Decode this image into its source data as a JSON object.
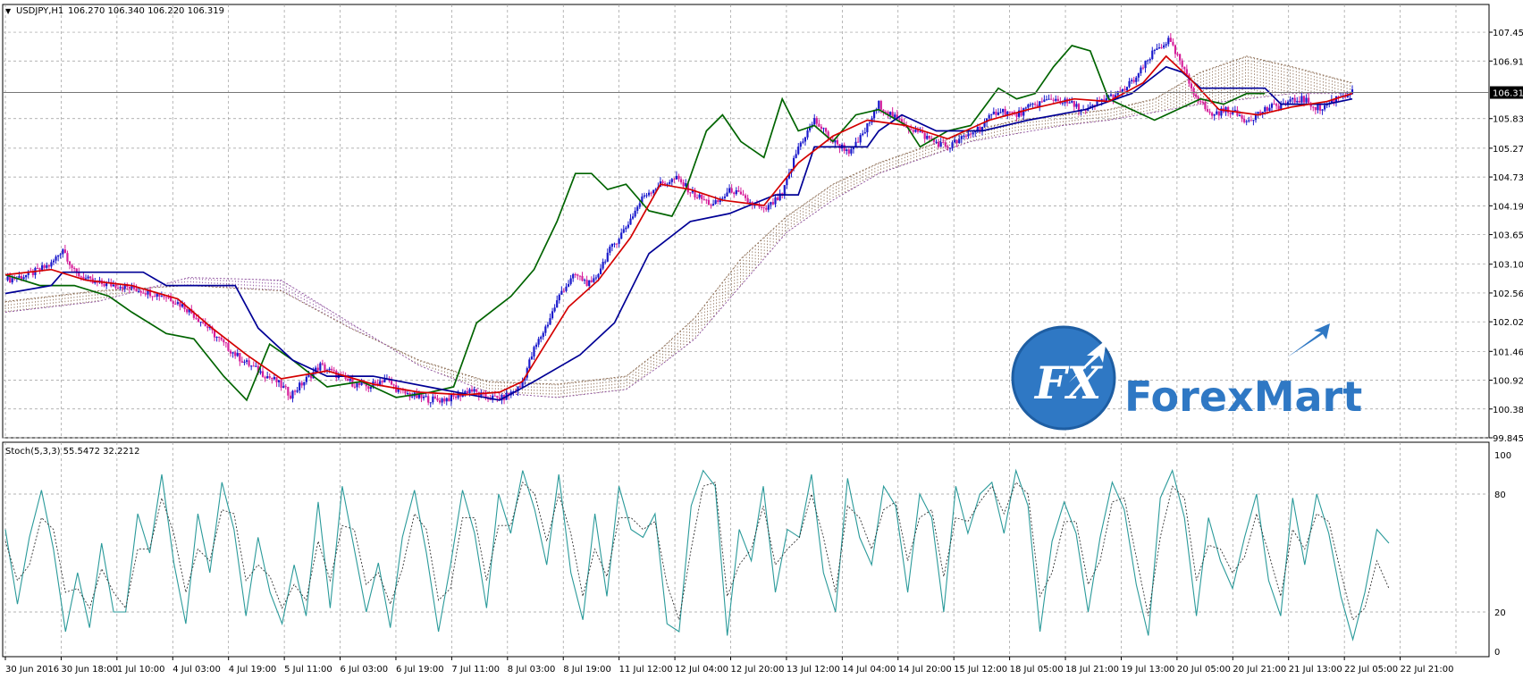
{
  "window": {
    "symbol_label": "USDJPY,H1",
    "ohlc_label": "106.270 106.340 106.220 106.319",
    "current_price_label": "106.319"
  },
  "logo": {
    "text": "ForexMart",
    "mark": "FX"
  },
  "colors": {
    "candle_bull": "#1a1acc",
    "candle_bear": "#d61f9a",
    "tenkan": "#d40000",
    "kijun": "#000096",
    "chikou": "#006400",
    "kumo_a": "#8a6a50",
    "kumo_b": "#8a4a9a",
    "stoch_main": "#2a9a9a",
    "stoch_signal": "#333333",
    "grid": "#9a9a9a",
    "logo_blue": "#2f78c4"
  },
  "chart_data": [
    {
      "type": "candlestick",
      "symbol": "USDJPY",
      "timeframe": "H1",
      "indicators": [
        "Ichimoku",
        "Kumo"
      ],
      "ylim": [
        99.845,
        107.97
      ],
      "y_ticks": [
        "107.450",
        "106.910",
        "105.830",
        "105.275",
        "104.735",
        "104.195",
        "103.655",
        "103.100",
        "102.560",
        "102.020",
        "101.465",
        "100.925",
        "100.385",
        "99.845"
      ],
      "x_ticks": [
        "30 Jun 2016",
        "30 Jun 18:00",
        "1 Jul 10:00",
        "4 Jul 03:00",
        "4 Jul 19:00",
        "5 Jul 11:00",
        "6 Jul 03:00",
        "6 Jul 19:00",
        "7 Jul 11:00",
        "8 Jul 03:00",
        "8 Jul 19:00",
        "11 Jul 12:00",
        "12 Jul 04:00",
        "12 Jul 20:00",
        "13 Jul 12:00",
        "14 Jul 04:00",
        "14 Jul 20:00",
        "15 Jul 12:00",
        "18 Jul 05:00",
        "18 Jul 21:00",
        "19 Jul 13:00",
        "20 Jul 05:00",
        "20 Jul 21:00",
        "21 Jul 13:00",
        "22 Jul 05:00",
        "22 Jul 21:00"
      ],
      "close_path": [
        [
          0,
          102.8
        ],
        [
          10,
          102.9
        ],
        [
          20,
          103.1
        ],
        [
          25,
          103.4
        ],
        [
          30,
          102.95
        ],
        [
          38,
          102.75
        ],
        [
          50,
          102.7
        ],
        [
          60,
          102.6
        ],
        [
          70,
          102.5
        ],
        [
          78,
          102.3
        ],
        [
          86,
          102.0
        ],
        [
          95,
          101.6
        ],
        [
          103,
          101.3
        ],
        [
          110,
          101.1
        ],
        [
          118,
          100.9
        ],
        [
          124,
          100.65
        ],
        [
          130,
          100.9
        ],
        [
          137,
          101.2
        ],
        [
          145,
          101.0
        ],
        [
          152,
          100.85
        ],
        [
          158,
          100.8
        ],
        [
          165,
          100.95
        ],
        [
          172,
          100.7
        ],
        [
          180,
          100.6
        ],
        [
          188,
          100.55
        ],
        [
          195,
          100.6
        ],
        [
          202,
          100.75
        ],
        [
          209,
          100.6
        ],
        [
          216,
          100.58
        ],
        [
          224,
          100.8
        ],
        [
          230,
          101.5
        ],
        [
          236,
          102.0
        ],
        [
          242,
          102.6
        ],
        [
          248,
          102.9
        ],
        [
          255,
          102.7
        ],
        [
          262,
          103.3
        ],
        [
          270,
          103.8
        ],
        [
          278,
          104.4
        ],
        [
          285,
          104.6
        ],
        [
          292,
          104.7
        ],
        [
          300,
          104.4
        ],
        [
          308,
          104.2
        ],
        [
          316,
          104.5
        ],
        [
          322,
          104.3
        ],
        [
          330,
          104.1
        ],
        [
          338,
          104.4
        ],
        [
          345,
          105.3
        ],
        [
          352,
          105.8
        ],
        [
          360,
          105.4
        ],
        [
          368,
          105.2
        ],
        [
          374,
          105.6
        ],
        [
          380,
          106.1
        ],
        [
          388,
          105.8
        ],
        [
          396,
          105.6
        ],
        [
          404,
          105.4
        ],
        [
          410,
          105.3
        ],
        [
          418,
          105.5
        ],
        [
          425,
          105.7
        ],
        [
          432,
          106.0
        ],
        [
          440,
          105.9
        ],
        [
          448,
          106.1
        ],
        [
          456,
          106.2
        ],
        [
          464,
          106.1
        ],
        [
          470,
          105.95
        ],
        [
          478,
          106.2
        ],
        [
          485,
          106.3
        ],
        [
          492,
          106.6
        ],
        [
          500,
          107.1
        ],
        [
          506,
          107.3
        ],
        [
          511,
          106.9
        ],
        [
          516,
          106.4
        ],
        [
          524,
          105.9
        ],
        [
          532,
          106.0
        ],
        [
          540,
          105.8
        ],
        [
          548,
          106.0
        ],
        [
          556,
          106.1
        ],
        [
          564,
          106.2
        ],
        [
          572,
          106.0
        ],
        [
          580,
          106.25
        ],
        [
          586,
          106.319
        ]
      ],
      "tenkan_path": [
        [
          0,
          102.9
        ],
        [
          20,
          103.0
        ],
        [
          35,
          102.8
        ],
        [
          55,
          102.7
        ],
        [
          75,
          102.45
        ],
        [
          90,
          101.9
        ],
        [
          105,
          101.4
        ],
        [
          120,
          100.95
        ],
        [
          140,
          101.1
        ],
        [
          160,
          100.85
        ],
        [
          180,
          100.7
        ],
        [
          200,
          100.65
        ],
        [
          215,
          100.7
        ],
        [
          225,
          100.9
        ],
        [
          235,
          101.6
        ],
        [
          245,
          102.3
        ],
        [
          258,
          102.8
        ],
        [
          272,
          103.6
        ],
        [
          285,
          104.6
        ],
        [
          298,
          104.5
        ],
        [
          312,
          104.3
        ],
        [
          330,
          104.2
        ],
        [
          345,
          105.0
        ],
        [
          360,
          105.5
        ],
        [
          375,
          105.8
        ],
        [
          392,
          105.7
        ],
        [
          410,
          105.45
        ],
        [
          428,
          105.8
        ],
        [
          445,
          106.0
        ],
        [
          465,
          106.2
        ],
        [
          480,
          106.15
        ],
        [
          495,
          106.5
        ],
        [
          505,
          107.0
        ],
        [
          515,
          106.6
        ],
        [
          528,
          106.0
        ],
        [
          545,
          105.9
        ],
        [
          560,
          106.05
        ],
        [
          575,
          106.15
        ],
        [
          586,
          106.3
        ]
      ],
      "kijun_path": [
        [
          0,
          102.55
        ],
        [
          20,
          102.7
        ],
        [
          25,
          102.95
        ],
        [
          60,
          102.95
        ],
        [
          70,
          102.7
        ],
        [
          100,
          102.7
        ],
        [
          110,
          101.9
        ],
        [
          125,
          101.3
        ],
        [
          140,
          101.0
        ],
        [
          160,
          101.0
        ],
        [
          190,
          100.75
        ],
        [
          215,
          100.55
        ],
        [
          230,
          100.9
        ],
        [
          250,
          101.4
        ],
        [
          265,
          102.0
        ],
        [
          280,
          103.3
        ],
        [
          298,
          103.9
        ],
        [
          315,
          104.05
        ],
        [
          335,
          104.4
        ],
        [
          345,
          104.4
        ],
        [
          352,
          105.3
        ],
        [
          375,
          105.3
        ],
        [
          380,
          105.6
        ],
        [
          390,
          105.9
        ],
        [
          405,
          105.6
        ],
        [
          425,
          105.6
        ],
        [
          445,
          105.8
        ],
        [
          470,
          106.0
        ],
        [
          490,
          106.3
        ],
        [
          505,
          106.8
        ],
        [
          512,
          106.7
        ],
        [
          520,
          106.4
        ],
        [
          548,
          106.4
        ],
        [
          555,
          106.1
        ],
        [
          575,
          106.1
        ],
        [
          586,
          106.2
        ]
      ],
      "chikou_path": [
        [
          0,
          102.9
        ],
        [
          15,
          102.7
        ],
        [
          30,
          102.7
        ],
        [
          45,
          102.5
        ],
        [
          55,
          102.2
        ],
        [
          70,
          101.8
        ],
        [
          82,
          101.7
        ],
        [
          95,
          101.0
        ],
        [
          105,
          100.55
        ],
        [
          115,
          101.6
        ],
        [
          125,
          101.3
        ],
        [
          140,
          100.8
        ],
        [
          155,
          100.9
        ],
        [
          170,
          100.6
        ],
        [
          185,
          100.7
        ],
        [
          195,
          100.8
        ],
        [
          205,
          102.0
        ],
        [
          220,
          102.5
        ],
        [
          230,
          103.0
        ],
        [
          240,
          103.9
        ],
        [
          248,
          104.8
        ],
        [
          255,
          104.8
        ],
        [
          262,
          104.5
        ],
        [
          270,
          104.6
        ],
        [
          280,
          104.1
        ],
        [
          290,
          104.0
        ],
        [
          296,
          104.5
        ],
        [
          305,
          105.6
        ],
        [
          312,
          105.9
        ],
        [
          320,
          105.4
        ],
        [
          330,
          105.1
        ],
        [
          338,
          106.2
        ],
        [
          345,
          105.6
        ],
        [
          352,
          105.7
        ],
        [
          360,
          105.4
        ],
        [
          370,
          105.9
        ],
        [
          380,
          106.0
        ],
        [
          392,
          105.7
        ],
        [
          398,
          105.3
        ],
        [
          410,
          105.6
        ],
        [
          420,
          105.7
        ],
        [
          432,
          106.4
        ],
        [
          440,
          106.2
        ],
        [
          448,
          106.3
        ],
        [
          456,
          106.8
        ],
        [
          464,
          107.2
        ],
        [
          472,
          107.1
        ],
        [
          480,
          106.2
        ],
        [
          490,
          106.0
        ],
        [
          500,
          105.8
        ],
        [
          510,
          106.0
        ],
        [
          520,
          106.2
        ],
        [
          530,
          106.1
        ],
        [
          540,
          106.3
        ],
        [
          548,
          106.3
        ]
      ],
      "kumo": {
        "span_a": [
          [
            0,
            102.4
          ],
          [
            40,
            102.6
          ],
          [
            80,
            102.7
          ],
          [
            120,
            102.6
          ],
          [
            150,
            101.9
          ],
          [
            180,
            101.3
          ],
          [
            210,
            100.9
          ],
          [
            240,
            100.85
          ],
          [
            270,
            101.0
          ],
          [
            285,
            101.5
          ],
          [
            300,
            102.1
          ],
          [
            320,
            103.2
          ],
          [
            340,
            104.0
          ],
          [
            360,
            104.6
          ],
          [
            380,
            105.0
          ],
          [
            400,
            105.3
          ],
          [
            420,
            105.6
          ],
          [
            440,
            105.8
          ],
          [
            460,
            105.9
          ],
          [
            480,
            106.0
          ],
          [
            500,
            106.2
          ],
          [
            520,
            106.7
          ],
          [
            540,
            107.0
          ],
          [
            560,
            106.8
          ],
          [
            586,
            106.5
          ]
        ],
        "span_b": [
          [
            0,
            102.2
          ],
          [
            40,
            102.4
          ],
          [
            80,
            102.85
          ],
          [
            120,
            102.8
          ],
          [
            150,
            102.0
          ],
          [
            180,
            101.2
          ],
          [
            210,
            100.7
          ],
          [
            240,
            100.6
          ],
          [
            270,
            100.75
          ],
          [
            285,
            101.2
          ],
          [
            300,
            101.7
          ],
          [
            320,
            102.7
          ],
          [
            340,
            103.7
          ],
          [
            360,
            104.3
          ],
          [
            380,
            104.8
          ],
          [
            400,
            105.1
          ],
          [
            420,
            105.4
          ],
          [
            440,
            105.55
          ],
          [
            460,
            105.7
          ],
          [
            480,
            105.8
          ],
          [
            500,
            105.95
          ],
          [
            520,
            106.1
          ],
          [
            540,
            106.2
          ],
          [
            560,
            106.3
          ],
          [
            586,
            106.3
          ]
        ]
      }
    },
    {
      "type": "line",
      "indicator": "Stochastic",
      "label": "Stoch(5,3,3) 55.5472 32.2212",
      "ylim": [
        0,
        100
      ],
      "y_ticks": [
        "100",
        "80",
        "20",
        "0"
      ],
      "series": [
        {
          "role": "main",
          "values": [
            62,
            24,
            58,
            82,
            52,
            10,
            40,
            12,
            55,
            20,
            20,
            70,
            50,
            90,
            45,
            14,
            70,
            40,
            86,
            62,
            18,
            58,
            30,
            14,
            44,
            18,
            76,
            22,
            84,
            52,
            20,
            45,
            12,
            58,
            82,
            50,
            10,
            44,
            82,
            60,
            22,
            80,
            60,
            92,
            72,
            44,
            90,
            40,
            16,
            70,
            28,
            84,
            62,
            58,
            70,
            14,
            10,
            74,
            92,
            84,
            8,
            62,
            46,
            84,
            30,
            62,
            58,
            90,
            40,
            20,
            88,
            58,
            44,
            84,
            74,
            30,
            80,
            68,
            20,
            84,
            60,
            80,
            86,
            60,
            92,
            74,
            10,
            56,
            76,
            60,
            20,
            58,
            86,
            72,
            34,
            8,
            78,
            92,
            68,
            18,
            68,
            46,
            32,
            58,
            80,
            36,
            18,
            78,
            44,
            80,
            60,
            28,
            6,
            30,
            62,
            55
          ]
        },
        {
          "role": "signal",
          "values": [
            56,
            36,
            44,
            68,
            62,
            30,
            32,
            22,
            42,
            30,
            22,
            52,
            52,
            78,
            60,
            30,
            52,
            46,
            72,
            70,
            36,
            44,
            38,
            22,
            34,
            26,
            56,
            36,
            64,
            62,
            34,
            40,
            24,
            42,
            70,
            62,
            26,
            32,
            68,
            68,
            36,
            64,
            64,
            86,
            80,
            56,
            80,
            60,
            28,
            52,
            38,
            68,
            68,
            62,
            66,
            34,
            16,
            52,
            84,
            86,
            28,
            44,
            52,
            74,
            44,
            52,
            58,
            80,
            58,
            30,
            74,
            68,
            52,
            72,
            76,
            46,
            68,
            72,
            38,
            68,
            66,
            76,
            84,
            70,
            86,
            80,
            28,
            40,
            66,
            66,
            34,
            46,
            76,
            78,
            48,
            18,
            58,
            84,
            78,
            36,
            54,
            52,
            40,
            48,
            70,
            50,
            28,
            62,
            52,
            70,
            66,
            40,
            16,
            22,
            46,
            32
          ]
        }
      ]
    }
  ]
}
